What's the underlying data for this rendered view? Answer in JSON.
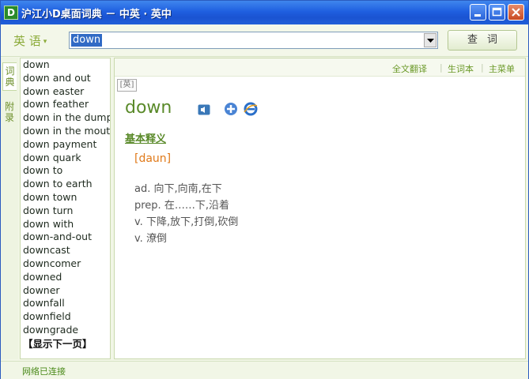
{
  "window": {
    "title": "沪江小D桌面词典 － 中英 · 英中",
    "logo_letter": "D"
  },
  "search": {
    "language": "英 语",
    "query": "down",
    "button_label": "查词"
  },
  "tabs": [
    {
      "label": "词典",
      "active": true
    },
    {
      "label": "附录",
      "active": false
    }
  ],
  "word_list": {
    "items": [
      "down",
      "down and out",
      "down easter",
      "down feather",
      "down in the dumps",
      "down in the mouth",
      "down payment",
      "down quark",
      "down to",
      "down to earth",
      "down town",
      "down turn",
      "down with",
      "down-and-out",
      "downcast",
      "downcomer",
      "downed",
      "downer",
      "downfall",
      "downfield",
      "downgrade"
    ],
    "next_page": "【显示下一页】"
  },
  "top_links": [
    "全文翻译",
    "生词本",
    "主菜单"
  ],
  "entry": {
    "lang_badge": "[英]",
    "headword": "down",
    "section_title": "基本释义",
    "phonetic": "[daun]",
    "definitions": [
      "ad. 向下,向南,在下",
      "prep. 在……下,沿着",
      "v. 下降,放下,打倒,砍倒",
      "v. 潦倒"
    ]
  },
  "status": "网络已连接",
  "colors": {
    "accent": "#5a8a2a",
    "titlebar": "#1f5fe0",
    "phonetic": "#e07a1a"
  }
}
